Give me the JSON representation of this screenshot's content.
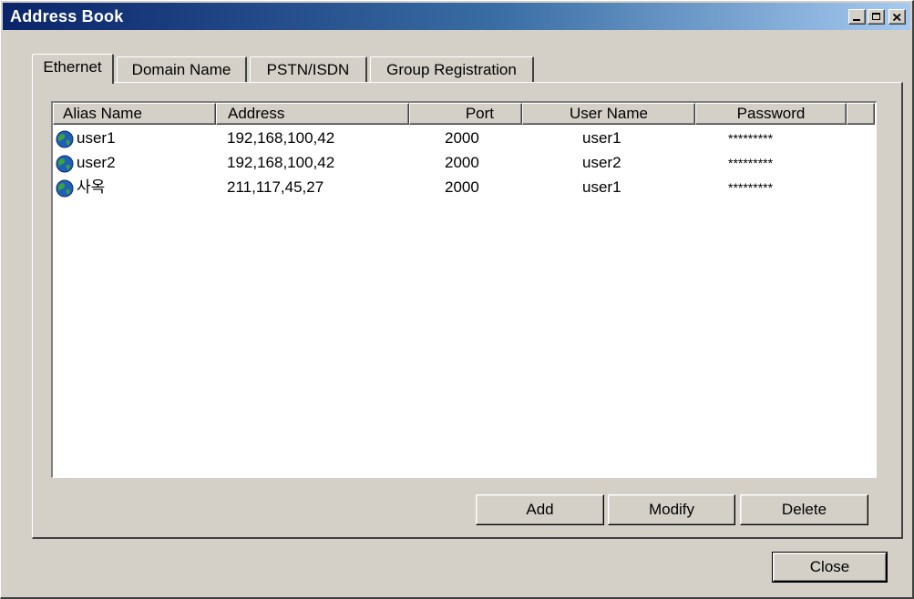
{
  "window": {
    "title": "Address Book",
    "controls": {
      "minimize": "_",
      "maximize": "□",
      "close": "×"
    }
  },
  "tabs": [
    {
      "label": "Ethernet",
      "active": true
    },
    {
      "label": "Domain Name",
      "active": false
    },
    {
      "label": "PSTN/ISDN",
      "active": false
    },
    {
      "label": "Group Registration",
      "active": false
    }
  ],
  "list": {
    "columns": [
      "Alias Name",
      "Address",
      "Port",
      "User Name",
      "Password"
    ],
    "rows": [
      {
        "alias": "user1",
        "address": "192,168,100,42",
        "port": "2000",
        "user": "user1",
        "password": "*********",
        "icon": "globe-icon"
      },
      {
        "alias": "user2",
        "address": "192,168,100,42",
        "port": "2000",
        "user": "user2",
        "password": "*********",
        "icon": "globe-icon"
      },
      {
        "alias": "사옥",
        "address": "211,117,45,27",
        "port": "2000",
        "user": "user1",
        "password": "*********",
        "icon": "globe-icon"
      }
    ]
  },
  "buttons": {
    "add": "Add",
    "modify": "Modify",
    "delete": "Delete",
    "close": "Close"
  }
}
